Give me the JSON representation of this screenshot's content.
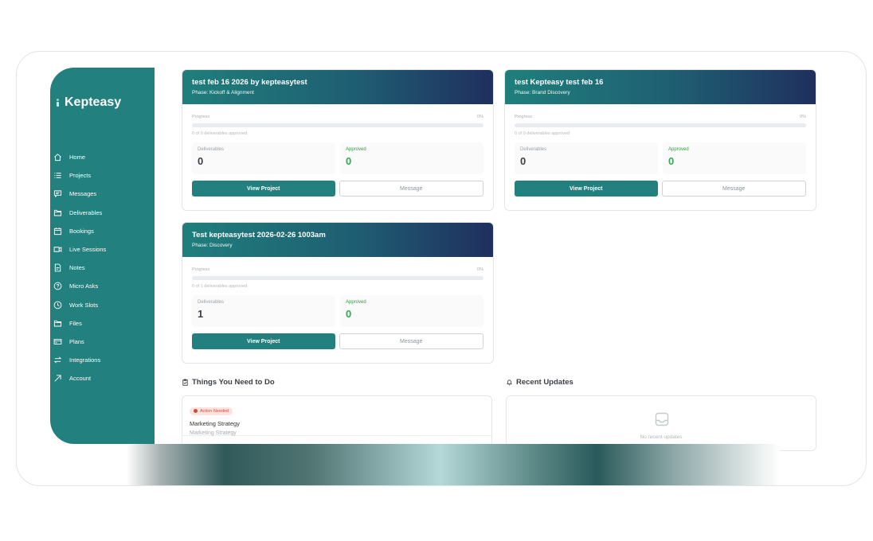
{
  "brand": {
    "name": "Kepteasy"
  },
  "nav": [
    {
      "label": "Home",
      "icon": "home-icon"
    },
    {
      "label": "Projects",
      "icon": "list-icon"
    },
    {
      "label": "Messages",
      "icon": "message-icon"
    },
    {
      "label": "Deliverables",
      "icon": "folder-icon"
    },
    {
      "label": "Bookings",
      "icon": "calendar-icon"
    },
    {
      "label": "Live Sessions",
      "icon": "video-icon"
    },
    {
      "label": "Notes",
      "icon": "note-icon"
    },
    {
      "label": "Micro Asks",
      "icon": "question-icon"
    },
    {
      "label": "Work Slots",
      "icon": "clock-icon"
    },
    {
      "label": "Files",
      "icon": "folder-icon"
    },
    {
      "label": "Plans",
      "icon": "card-icon"
    },
    {
      "label": "Integrations",
      "icon": "swap-icon"
    },
    {
      "label": "Account",
      "icon": "arrow-up-right-icon"
    }
  ],
  "projects": [
    {
      "title": "test feb 16 2026 by kepteasytest",
      "phase": "Phase: Kickoff & Alignment",
      "progress_label": "Progress",
      "progress_pct": "0%",
      "progress": 0,
      "approved_text": "0 of 0 deliverables approved",
      "deliverables_label": "Deliverables",
      "deliverables": "0",
      "approved_label": "Approved",
      "approved": "0",
      "view_label": "View Project",
      "message_label": "Message"
    },
    {
      "title": "test Kepteasy test feb 16",
      "phase": "Phase: Brand Discovery",
      "progress_label": "Progress",
      "progress_pct": "0%",
      "progress": 0,
      "approved_text": "0 of 0 deliverables approved",
      "deliverables_label": "Deliverables",
      "deliverables": "0",
      "approved_label": "Approved",
      "approved": "0",
      "view_label": "View Project",
      "message_label": "Message"
    },
    {
      "title": "Test kepteasytest 2026-02-26 1003am",
      "phase": "Phase: Discovery",
      "progress_label": "Progress",
      "progress_pct": "0%",
      "progress": 0,
      "approved_text": "0 of 1 deliverables approved",
      "deliverables_label": "Deliverables",
      "deliverables": "1",
      "approved_label": "Approved",
      "approved": "0",
      "view_label": "View Project",
      "message_label": "Message"
    }
  ],
  "todo": {
    "title": "Things You Need to Do",
    "items": [
      {
        "badge": "Action Needed",
        "title": "Marketing Strategy",
        "subtitle": "Marketing Strategy"
      }
    ]
  },
  "updates": {
    "title": "Recent Updates",
    "empty_text": "No recent updates"
  },
  "colors": {
    "accent": "#22807e",
    "header_end": "#1f2f5e",
    "success": "#34a853",
    "badge_bg": "#fde2de"
  }
}
